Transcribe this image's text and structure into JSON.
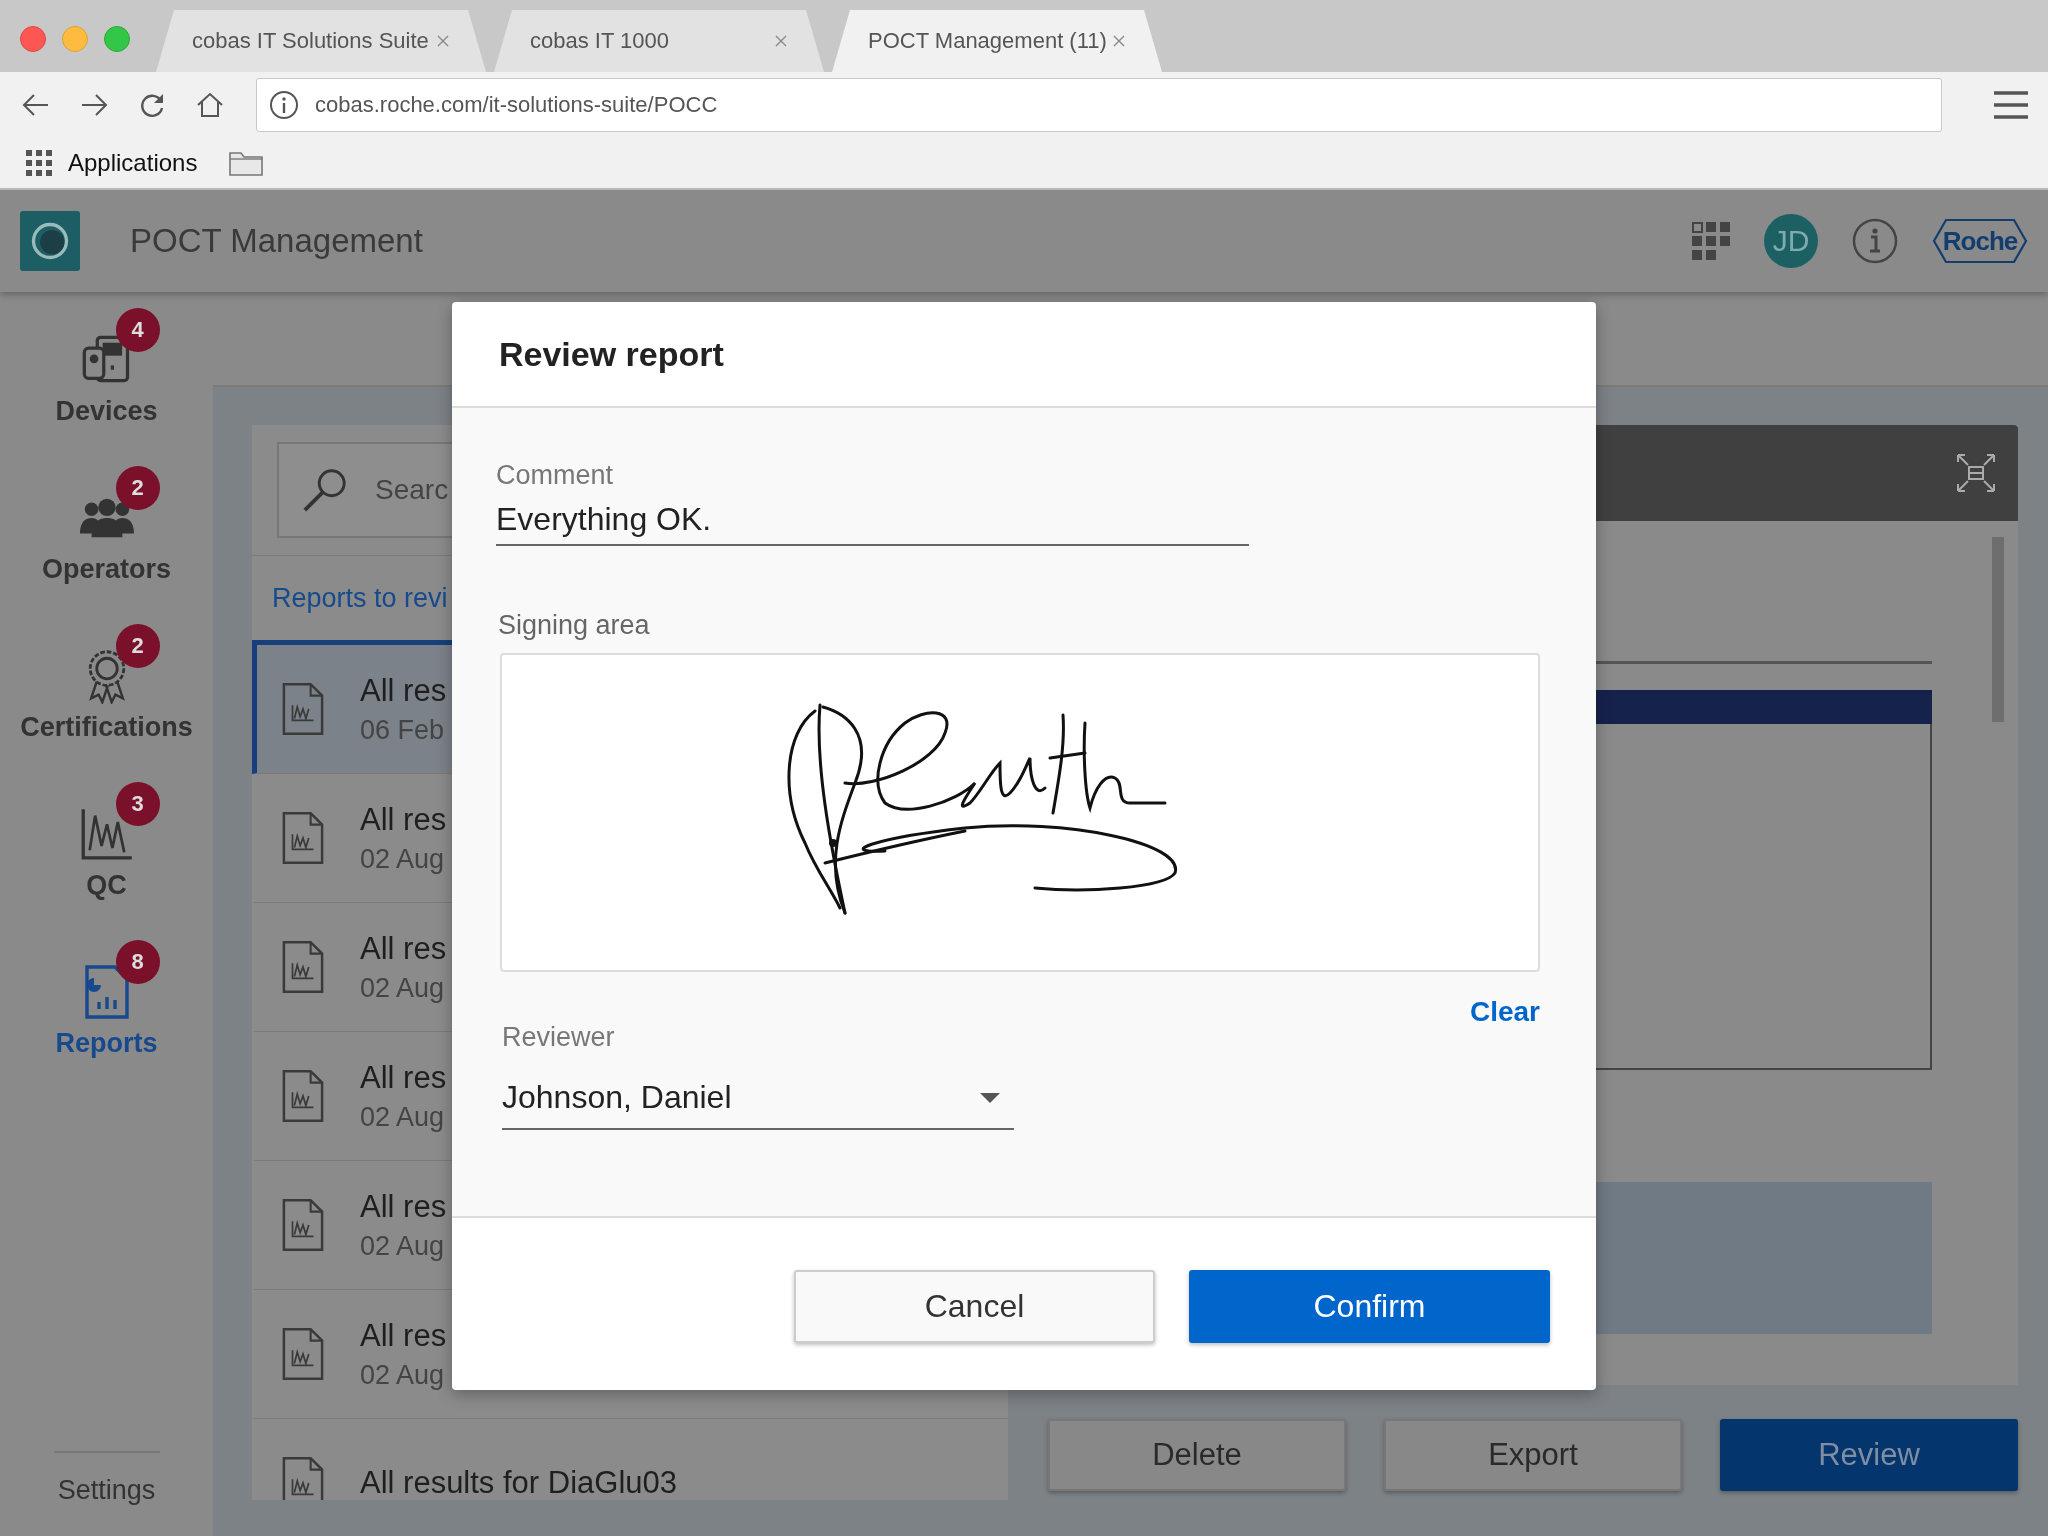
{
  "browser": {
    "tabs": [
      {
        "title": "cobas IT Solutions Suite",
        "selected": false
      },
      {
        "title": "cobas IT 1000",
        "selected": false
      },
      {
        "title": "POCT Management (11)",
        "selected": true
      }
    ],
    "address": "cobas.roche.com/it-solutions-suite/POCC",
    "bookmarks": [
      {
        "label": "Applications"
      }
    ]
  },
  "app": {
    "title": "POCT Management",
    "user_initials": "JD",
    "brand": "Roche"
  },
  "sidebar": {
    "items": [
      {
        "kind": "devices",
        "label": "Devices",
        "badge": "4",
        "selected": false
      },
      {
        "kind": "operators",
        "label": "Operators",
        "badge": "2",
        "selected": false
      },
      {
        "kind": "certifications",
        "label": "Certifications",
        "badge": "2",
        "selected": false
      },
      {
        "kind": "qc",
        "label": "QC",
        "badge": "3",
        "selected": false
      },
      {
        "kind": "reports",
        "label": "Reports",
        "badge": "8",
        "selected": true
      }
    ],
    "settings": "Settings"
  },
  "reports_panel": {
    "search_placeholder": "Searc",
    "tab": "Reports to revi",
    "rows": [
      {
        "title": "All res",
        "date": "06 Feb",
        "selected": true
      },
      {
        "title": "All res",
        "date": "02 Aug",
        "selected": false
      },
      {
        "title": "All res",
        "date": "02 Aug",
        "selected": false
      },
      {
        "title": "All res",
        "date": "02 Aug",
        "selected": false
      },
      {
        "title": "All res",
        "date": "02 Aug",
        "selected": false
      },
      {
        "title": "All res",
        "date": "02 Aug",
        "selected": false
      },
      {
        "title": "All results for DiaGlu03",
        "selected": false
      }
    ]
  },
  "actions": [
    {
      "label": "Delete",
      "kind": "secondary"
    },
    {
      "label": "Export",
      "kind": "secondary"
    },
    {
      "label": "Review",
      "kind": "primary"
    }
  ],
  "dialog": {
    "title": "Review report",
    "comment": {
      "label": "Comment",
      "value": "Everything OK."
    },
    "signing_area": {
      "label": "Signing area",
      "signed": true
    },
    "clear": "Clear",
    "reviewer": {
      "label": "Reviewer",
      "value": "Johnson, Daniel"
    },
    "buttons": [
      {
        "label": "Cancel",
        "kind": "secondary"
      },
      {
        "label": "Confirm",
        "kind": "primary"
      }
    ]
  }
}
